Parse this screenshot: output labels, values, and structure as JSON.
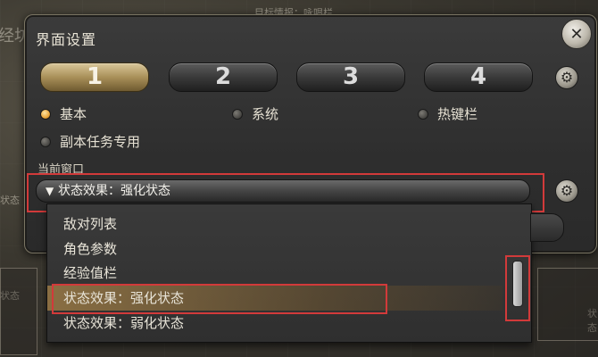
{
  "background": {
    "top_text": "目标情报：咏唱栏",
    "left_big": "经坊",
    "left_mid": "状态",
    "left_low": "状态",
    "right_low": "状态"
  },
  "window": {
    "title": "界面设置",
    "close_icon": "close-icon"
  },
  "tabs": [
    {
      "label": "1",
      "active": true
    },
    {
      "label": "2",
      "active": false
    },
    {
      "label": "3",
      "active": false
    },
    {
      "label": "4",
      "active": false
    }
  ],
  "radios": {
    "basic": "基本",
    "system": "系统",
    "hotbar": "热键栏",
    "duty": "副本任务专用"
  },
  "current_window_label": "当前窗口",
  "dropdown": {
    "arrow": "▼",
    "value": "状态效果：强化状态"
  },
  "list": {
    "items": [
      "敌对列表",
      "角色参数",
      "经验值栏",
      "状态效果：强化状态",
      "状态效果：弱化状态"
    ]
  },
  "colors": {
    "accent_gold": "#c9a75c",
    "highlight_red": "#d23a3a"
  }
}
